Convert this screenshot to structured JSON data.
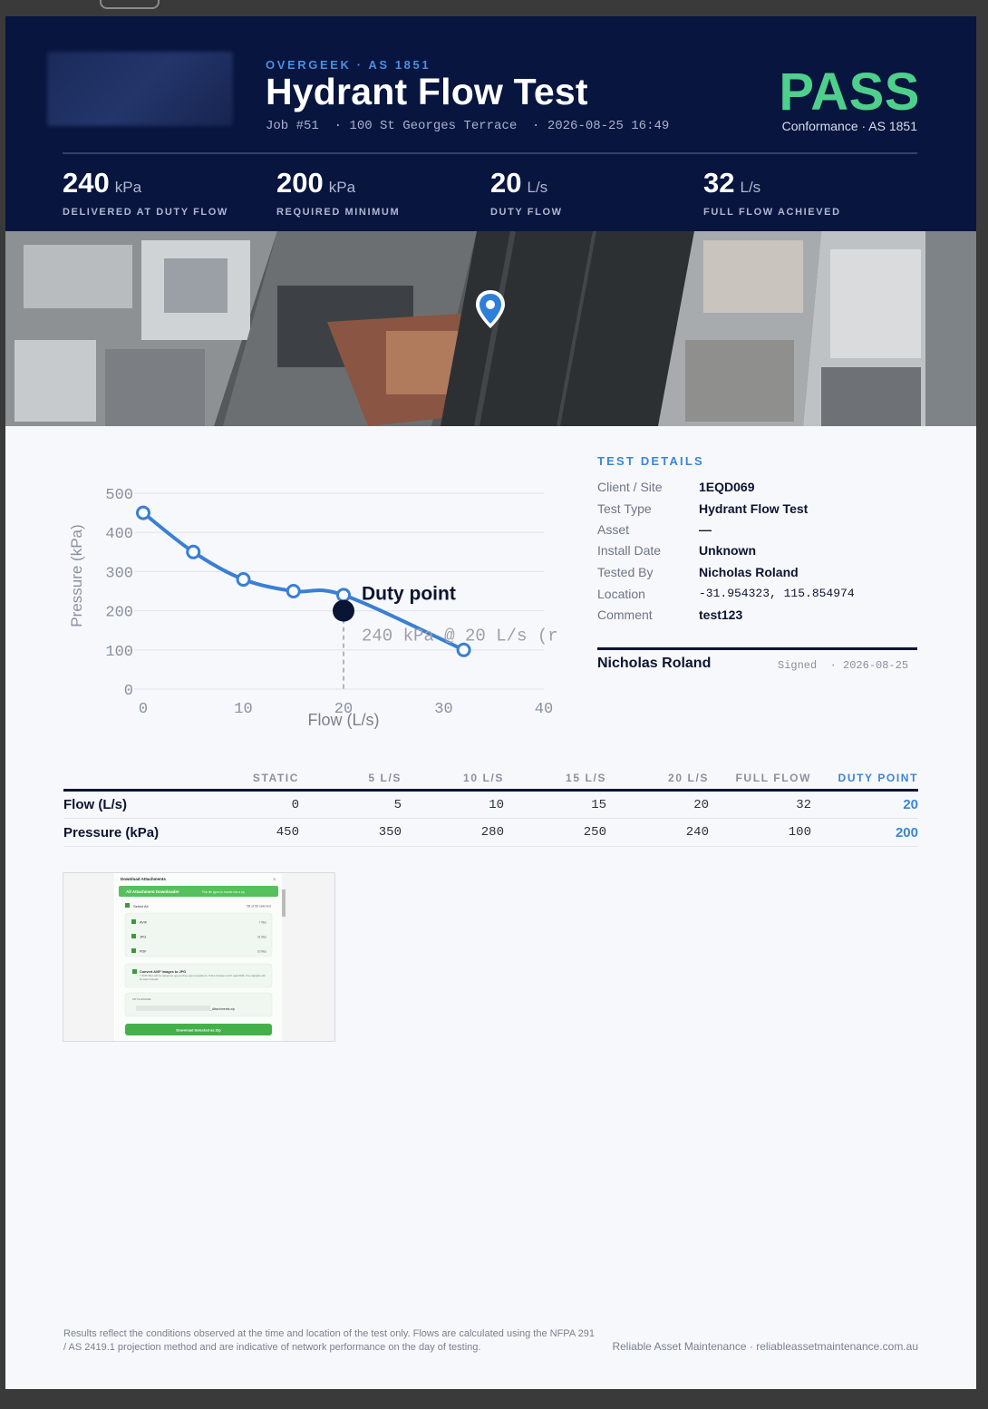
{
  "header": {
    "brand": "OVERGEEK · AS 1851",
    "title": "Hydrant Flow Test",
    "subline": "Job #51  · 100 St Georges Terrace  · 2026-08-25 16:49",
    "verdict": "PASS",
    "conformance": "Conformance · AS 1851",
    "accent_color": "#4fcf8c",
    "background_color": "#07153f"
  },
  "stats": [
    {
      "value": "240",
      "unit": "kPa",
      "label": "DELIVERED AT DUTY FLOW"
    },
    {
      "value": "200",
      "unit": "kPa",
      "label": "REQUIRED MINIMUM"
    },
    {
      "value": "20",
      "unit": "L/s",
      "label": "DUTY FLOW"
    },
    {
      "value": "32",
      "unit": "L/s",
      "label": "FULL FLOW ACHIEVED"
    }
  ],
  "map": {
    "marker_icon": "map-pin-icon"
  },
  "chart_data": {
    "type": "line",
    "xlabel": "Flow (L/s)",
    "ylabel": "Pressure (kPa)",
    "xlim": [
      0,
      40
    ],
    "ylim": [
      0,
      500
    ],
    "xticks": [
      "0",
      "10",
      "20",
      "30",
      "40"
    ],
    "yticks": [
      "0",
      "100",
      "200",
      "300",
      "400",
      "500"
    ],
    "grid": true,
    "series": [
      {
        "x": [
          0,
          5,
          10,
          15,
          20,
          32
        ],
        "y": [
          450,
          350,
          280,
          250,
          240,
          100
        ],
        "color": "#3a7fd4"
      }
    ],
    "duty_point": {
      "x": 20,
      "y": 200,
      "label": "Duty point",
      "annotation": "240 kPa @ 20 L/s (r"
    }
  },
  "details": {
    "heading": "TEST DETAILS",
    "rows": [
      {
        "key": "Client / Site",
        "value": "1EQD069"
      },
      {
        "key": "Test Type",
        "value": "Hydrant Flow Test"
      },
      {
        "key": "Asset",
        "value": "—"
      },
      {
        "key": "Install Date",
        "value": "Unknown"
      },
      {
        "key": "Tested By",
        "value": "Nicholas Roland"
      },
      {
        "key": "Location",
        "value": "-31.954323, 115.854974"
      },
      {
        "key": "Comment",
        "value": "test123"
      }
    ],
    "signature_name": "Nicholas Roland",
    "signature_meta": "Signed  · 2026-08-25"
  },
  "table": {
    "headers": [
      "",
      "STATIC",
      "5 L/S",
      "10 L/S",
      "15 L/S",
      "20 L/S",
      "FULL FLOW",
      "DUTY POINT"
    ],
    "rows": [
      {
        "label": "Flow (L/s)",
        "cells": [
          "0",
          "5",
          "10",
          "15",
          "20",
          "32"
        ],
        "duty": "20"
      },
      {
        "label": "Pressure (kPa)",
        "cells": [
          "450",
          "350",
          "280",
          "250",
          "240",
          "100"
        ],
        "duty": "200"
      }
    ]
  },
  "attachment": {
    "title": "Download Attachments",
    "banner": "All Attachment Downloader",
    "banner_hint": "Pick file types to bundle into a zip",
    "select_all": "Select All",
    "selected_count": "58 of 58 selected",
    "types": [
      {
        "name": "AVIF",
        "count": "7 files"
      },
      {
        "name": "JPG",
        "count": "31 files"
      },
      {
        "name": "PDF",
        "count": "20 files"
      }
    ],
    "convert_title": "Convert AVIF images to JPG",
    "convert_desc": "7 AVIF files will be saved as .jpg so they open anywhere. If this browser can't read AVIF, the originals will be kept instead.",
    "zip_label": "ZIP FILENAME",
    "zip_suffix": "_Attachments.zip",
    "download_button": "Download Selected as Zip"
  },
  "footer": {
    "note": "Results reflect the conditions observed at the time and location of the test only. Flows are calculated using the NFPA 291 / AS 2419.1 projection method and are indicative of network performance on the day of testing.",
    "company": "Reliable Asset Maintenance · reliableassetmaintenance.com.au"
  }
}
